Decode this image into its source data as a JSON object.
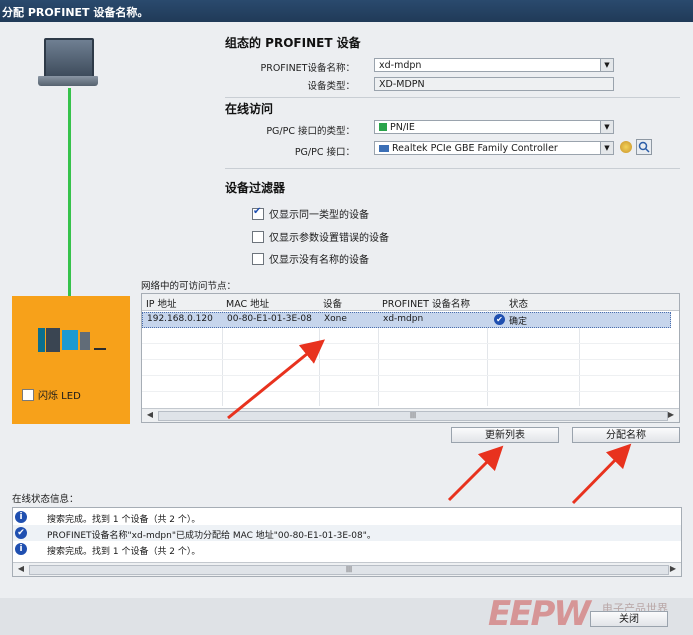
{
  "window": {
    "title": "分配 PROFINET 设备名称。"
  },
  "left_panel": {
    "flash_led_label": "闪烁 LED"
  },
  "config_section": {
    "title": "组态的 PROFINET 设备",
    "device_name_label": "PROFINET设备名称：",
    "device_name_value": "xd-mdpn",
    "device_type_label": "设备类型：",
    "device_type_value": "XD-MDPN"
  },
  "online_section": {
    "title": "在线访问",
    "interface_type_label": "PG/PC 接口的类型：",
    "interface_type_value": "PN/IE",
    "interface_label": "PG/PC 接口：",
    "interface_value": "Realtek PCIe GBE Family Controller"
  },
  "filter_section": {
    "title": "设备过滤器",
    "options": [
      {
        "label": "仅显示同一类型的设备",
        "checked": true
      },
      {
        "label": "仅显示参数设置错误的设备",
        "checked": false
      },
      {
        "label": "仅显示没有名称的设备",
        "checked": false
      }
    ]
  },
  "nodes_table": {
    "caption": "网络中的可访问节点：",
    "columns": [
      "IP 地址",
      "MAC 地址",
      "设备",
      "PROFINET 设备名称",
      "状态"
    ],
    "rows": [
      {
        "ip": "192.168.0.120",
        "mac": "00-80-E1-01-3E-08",
        "device": "Xone",
        "name": "xd-mdpn",
        "status": "确定"
      }
    ]
  },
  "buttons": {
    "refresh": "更新列表",
    "assign": "分配名称",
    "close": "关闭"
  },
  "status_section": {
    "caption": "在线状态信息：",
    "messages": [
      {
        "icon": "info",
        "text": "搜索完成。找到 1 个设备（共 2 个）。"
      },
      {
        "icon": "check",
        "text": "PROFINET设备名称\"xd-mdpn\"已成功分配给 MAC 地址\"00-80-E1-01-3E-08\"。"
      },
      {
        "icon": "info",
        "text": "搜索完成。找到 1 个设备（共 2 个）。"
      }
    ]
  },
  "watermark": {
    "logo": "EEPW",
    "tagline": "电子产品世界"
  },
  "colors": {
    "accent_orange": "#f7a11a",
    "link_green": "#36c24b",
    "arrow_red": "#e8321e",
    "selection": "#c6d5ec"
  }
}
